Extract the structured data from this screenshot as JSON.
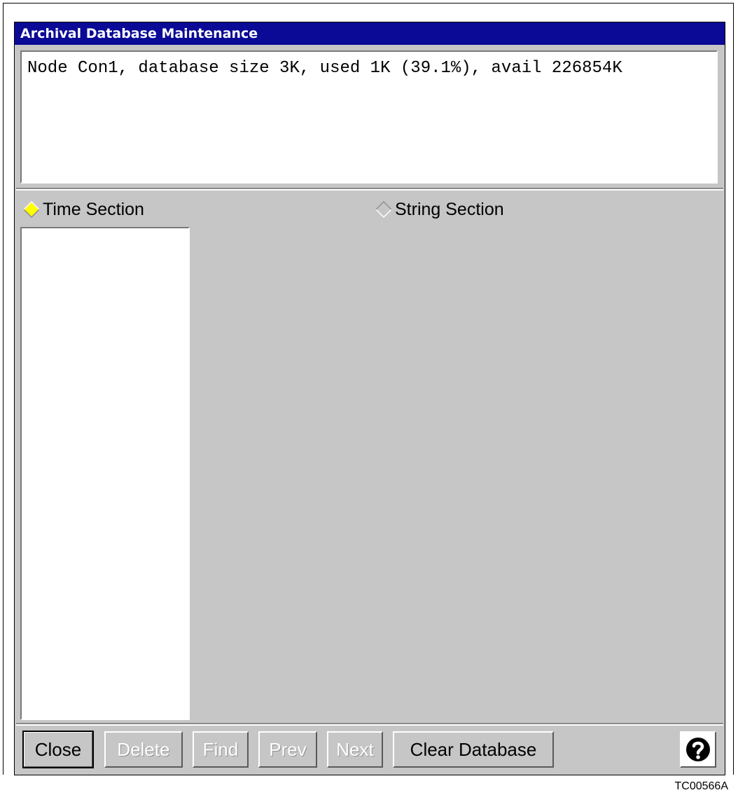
{
  "window": {
    "title": "Archival Database Maintenance"
  },
  "status": {
    "message": "Node Con1, database size 3K, used 1K (39.1%), avail 226854K"
  },
  "sections": {
    "time_label": "Time Section",
    "string_label": "String Section",
    "selected": "time"
  },
  "buttons": {
    "close": "Close",
    "delete": "Delete",
    "find": "Find",
    "prev": "Prev",
    "next": "Next",
    "clear_database": "Clear Database"
  },
  "icons": {
    "help": "help-icon",
    "radio_selected": "radio-diamond-selected-icon",
    "radio_unselected": "radio-diamond-unselected-icon"
  },
  "colors": {
    "titlebar": "#0a0a96",
    "radio_selected_fill": "#ffff00",
    "background": "#c6c6c6"
  },
  "figure": {
    "caption": "TC00566A"
  }
}
